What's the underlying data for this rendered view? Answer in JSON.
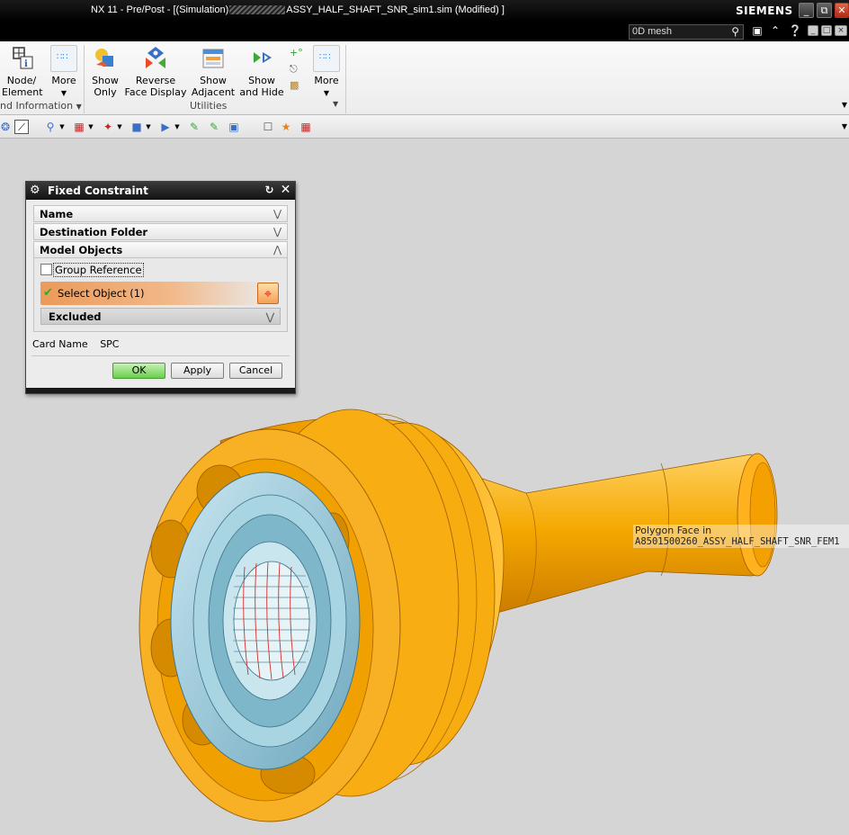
{
  "window": {
    "title_left": "NX 11 - Pre/Post - [(Simulation)",
    "title_right": "ASSY_HALF_SHAFT_SNR_sim1.sim (Modified) ]",
    "brand": "SIEMENS",
    "search_value": "0D mesh"
  },
  "ribbon": {
    "buttons": [
      {
        "label": "Node/\nElement"
      },
      {
        "label": "More"
      },
      {
        "label": "Show\nOnly"
      },
      {
        "label": "Reverse\nFace Display"
      },
      {
        "label": "Show\nAdjacent"
      },
      {
        "label": "Show\nand Hide"
      },
      {
        "label": "More"
      }
    ],
    "group_left": "nd Information",
    "group_utilities": "Utilities"
  },
  "dialog": {
    "title": "Fixed Constraint",
    "sections": {
      "name": "Name",
      "destination": "Destination Folder",
      "model_objects": "Model Objects"
    },
    "group_reference": "Group Reference",
    "select_object": "Select Object (1)",
    "excluded": "Excluded",
    "card_name_label": "Card Name",
    "card_name_value": "SPC",
    "ok": "OK",
    "apply": "Apply",
    "cancel": "Cancel"
  },
  "tooltip": {
    "line1": "Polygon Face in",
    "line2": "A8501500260_ASSY_HALF_SHAFT_SNR_FEM1"
  },
  "colors": {
    "part_orange": "#f5a800",
    "part_blue": "#8ec6d8",
    "viewport_bg": "#d5d5d5"
  }
}
